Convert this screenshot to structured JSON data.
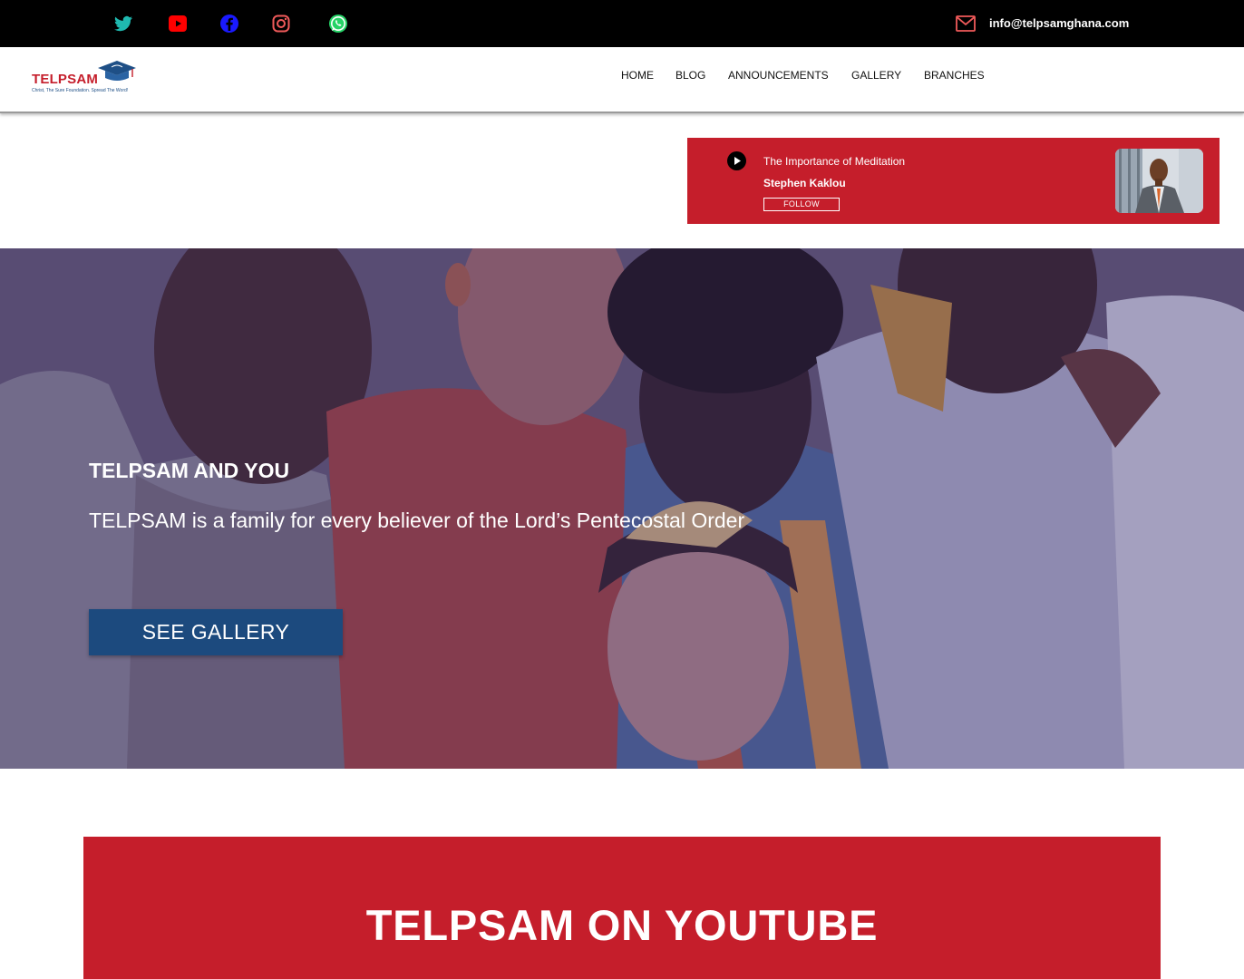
{
  "topbar": {
    "social": [
      {
        "name": "twitter-icon",
        "color": "#1da1f2"
      },
      {
        "name": "youtube-icon",
        "color": "#ff0000"
      },
      {
        "name": "facebook-icon",
        "color": "#1877f2"
      },
      {
        "name": "instagram-icon",
        "color": "#e1306c"
      },
      {
        "name": "whatsapp-icon",
        "color": "#25d366"
      }
    ],
    "mail_icon": "mail-icon",
    "email": "info@telpsamghana.com"
  },
  "header": {
    "logo_text": "TELPSAM",
    "logo_tagline": "Christ, The Sure Foundation. Spread The Word!",
    "nav": [
      "HOME",
      "BLOG",
      "ANNOUNCEMENTS",
      "GALLERY",
      "BRANCHES"
    ]
  },
  "sermon": {
    "play_icon": "play-icon",
    "title": "The Importance of Meditation",
    "author": "Stephen Kaklou",
    "follow_label": "FOLLOW"
  },
  "hero": {
    "heading": "TELPSAM AND YOU",
    "subheading": "TELPSAM is a family for every believer of the Lord’s Pentecostal Order",
    "button_label": "SEE GALLERY"
  },
  "youtube_section": {
    "title": "TELPSAM ON YOUTUBE"
  },
  "colors": {
    "brand_red": "#c51e2b",
    "brand_blue": "#1c4a7e",
    "topbar_bg": "#000000"
  }
}
